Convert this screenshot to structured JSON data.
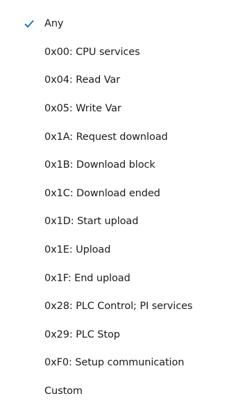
{
  "menu": {
    "items": [
      {
        "label": "Any",
        "checked": true,
        "icon": "checkmark-icon"
      },
      {
        "label": "0x00: CPU services",
        "checked": false
      },
      {
        "label": "0x04: Read Var",
        "checked": false
      },
      {
        "label": "0x05: Write Var",
        "checked": false
      },
      {
        "label": "0x1A: Request download",
        "checked": false
      },
      {
        "label": "0x1B: Download block",
        "checked": false
      },
      {
        "label": "0x1C: Download ended",
        "checked": false
      },
      {
        "label": "0x1D: Start upload",
        "checked": false
      },
      {
        "label": "0x1E: Upload",
        "checked": false
      },
      {
        "label": "0x1F: End upload",
        "checked": false
      },
      {
        "label": "0x28: PLC Control; PI services",
        "checked": false
      },
      {
        "label": "0x29: PLC Stop",
        "checked": false
      },
      {
        "label": "0xF0: Setup communication",
        "checked": false
      },
      {
        "label": "Custom",
        "checked": false
      }
    ]
  },
  "colors": {
    "accent": "#1e73c8",
    "text": "#1b1b1b",
    "background": "#ffffff"
  }
}
